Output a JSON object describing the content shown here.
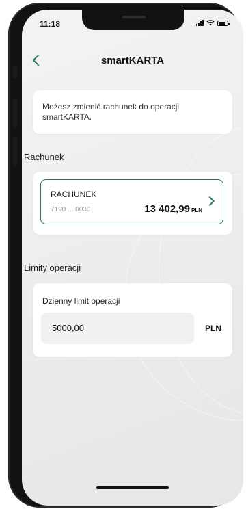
{
  "status_bar": {
    "time": "11:18"
  },
  "header": {
    "title": "smartKARTA"
  },
  "info": {
    "text": "Możesz zmienić rachunek do operacji smartKARTA."
  },
  "account_section": {
    "label": "Rachunek",
    "account": {
      "name": "RACHUNEK",
      "number": "7190 ... 0030",
      "balance": "13 402,99",
      "currency": "PLN"
    }
  },
  "limits_section": {
    "label": "Limity operacji",
    "daily_limit": {
      "label": "Dzienny limit operacji",
      "value": "5000,00",
      "currency": "PLN"
    }
  },
  "colors": {
    "accent": "#2a7a5a"
  }
}
